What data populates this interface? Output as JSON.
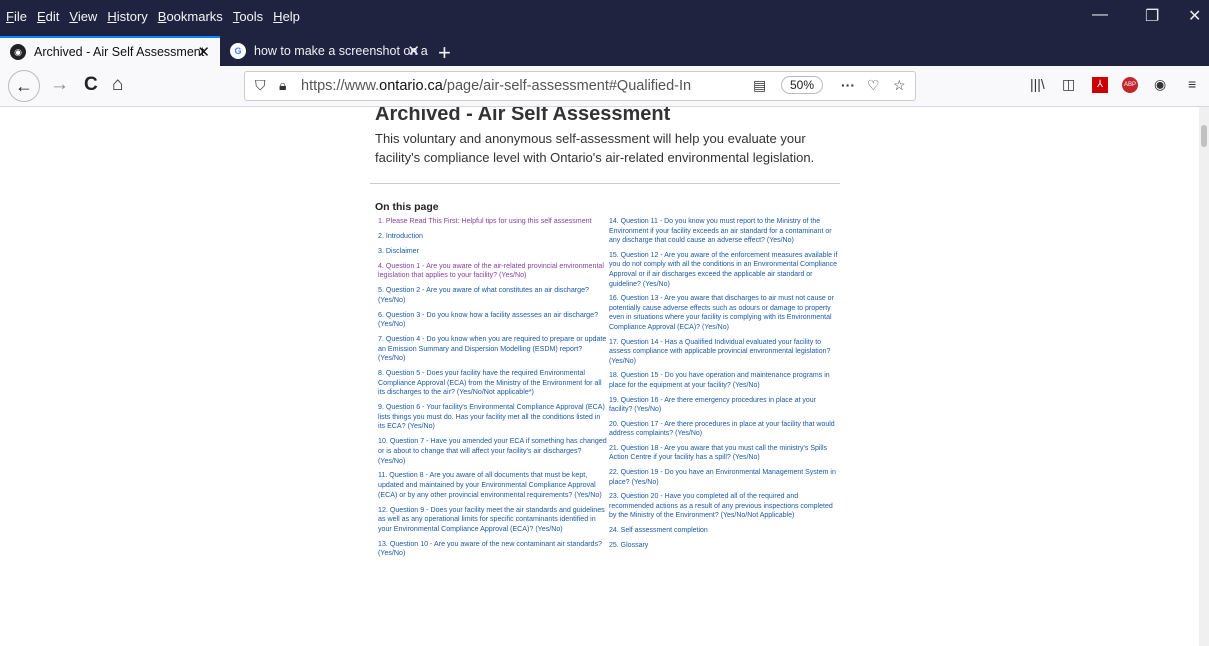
{
  "menubar": [
    "File",
    "Edit",
    "View",
    "History",
    "Bookmarks",
    "Tools",
    "Help"
  ],
  "window_controls": {
    "minimize": "—",
    "restore": "❐",
    "close": "✕"
  },
  "tabs": [
    {
      "title": "Archived - Air Self Assessment",
      "icon": "mask-icon",
      "close": "✕"
    },
    {
      "title": "how to make a screenshot on a",
      "icon": "google-icon",
      "close": "✕"
    }
  ],
  "new_tab": "+",
  "nav": {
    "back": "←",
    "forward": "→",
    "reload": "C",
    "home": "⌂"
  },
  "address": {
    "url_prefix": "https://www.",
    "url_domain": "ontario.ca",
    "url_path": "/page/air-self-assessment#Qualified-Individual-N",
    "zoom": "50%",
    "more": "···"
  },
  "page": {
    "title": "Archived - Air Self Assessment",
    "intro": "This voluntary and anonymous self-assessment will help you evaluate your facility's compliance level with Ontario's air-related environmental legislation.",
    "on_this_page": "On this page",
    "left_links": [
      "1. Please Read This First: Helpful tips for using this self assessment",
      "2. Introduction",
      "3. Disclaimer",
      "4. Question 1 - Are you aware of the air-related provincial environmental legislation that applies to your facility? (Yes/No)",
      "5. Question 2 - Are you aware of what constitutes an air discharge? (Yes/No)",
      "6. Question 3 - Do you know how a facility assesses an air discharge? (Yes/No)",
      "7. Question 4 - Do you know when you are required to prepare or update an Emission Summary and Dispersion Modelling (ESDM) report? (Yes/No)",
      "8. Question 5 - Does your facility have the required Environmental Compliance Approval (ECA) from the Ministry of the Environment for all its discharges to the air? (Yes/No/Not applicable*)",
      "9. Question 6 - Your facility's Environmental Compliance Approval (ECA) lists things you must do. Has your facility met all the conditions listed in its ECA? (Yes/No)",
      "10. Question 7 - Have you amended your ECA if something has changed or is about to change that will affect your facility's air discharges? (Yes/No)",
      "11. Question 8 - Are you aware of all documents that must be kept, updated and maintained by your Environmental Compliance Approval (ECA) or by any other provincial environmental requirements? (Yes/No)",
      "12. Question 9 - Does your facility meet the air standards and guidelines as well as any operational limits for specific contaminants identified in your Environmental Compliance Approval (ECA)? (Yes/No)",
      "13. Question 10 - Are you aware of the new contaminant air standards? (Yes/No)"
    ],
    "right_links": [
      "14. Question 11 - Do you know you must report to the Ministry of the Environment if your facility exceeds an air standard for a contaminant or any discharge that could cause an adverse effect? (Yes/No)",
      "15. Question 12 - Are you aware of the enforcement measures available if you do not comply with all the conditions in an Environmental Compliance Approval or if air discharges exceed the applicable air standard or guideline? (Yes/No)",
      "16. Question 13 - Are you aware that discharges to air must not cause or potentially cause adverse effects such as odours or damage to property even in situations where your facility is complying with its Environmental Compliance Approval (ECA)? (Yes/No)",
      "17. Question 14 - Has a Qualified Individual evaluated your facility to assess compliance with applicable provincial environmental legislation? (Yes/No)",
      "18. Question 15 - Do you have operation and maintenance programs in place for the equipment at your facility? (Yes/No)",
      "19. Question 16 - Are there emergency procedures in place at your facility? (Yes/No)",
      "20. Question 17 - Are there procedures in place at your facility that would address complaints? (Yes/No)",
      "21. Question 18 - Are you aware that you must call the ministry's Spills Action Centre if your facility has a spill? (Yes/No)",
      "22. Question 19 - Do you have an Environmental Management System in place? (Yes/No)",
      "23. Question 20 - Have you completed all of the required and recommended actions as a result of any previous inspections completed by the Ministry of the Environment? (Yes/No/Not Applicable)",
      "24. Self assessment completion",
      "25. Glossary"
    ]
  },
  "colors": {
    "chrome_dark": "#202340",
    "link": "#1a5aa8",
    "visited_link": "#8a3fa3",
    "active_tab_accent": "#0a84ff"
  }
}
